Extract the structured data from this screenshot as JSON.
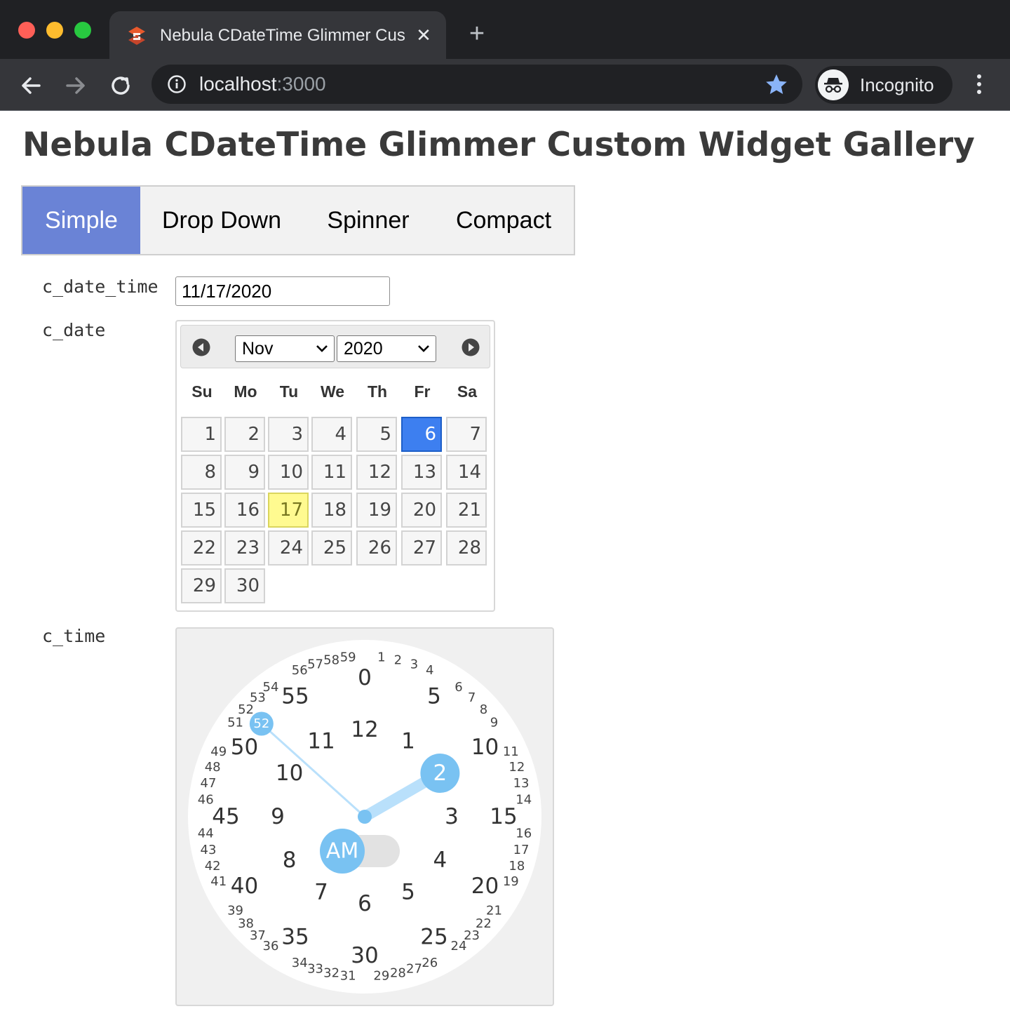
{
  "browser": {
    "tab_title": "Nebula CDateTime Glimmer Custom Widget Gallery",
    "tab_close": "✕",
    "new_tab": "+",
    "url_host": "localhost",
    "url_port": ":3000",
    "profile_label": "Incognito"
  },
  "page": {
    "title": "Nebula CDateTime Glimmer Custom Widget Gallery"
  },
  "tabs": [
    {
      "label": "Simple",
      "active": true
    },
    {
      "label": "Drop Down",
      "active": false
    },
    {
      "label": "Spinner",
      "active": false
    },
    {
      "label": "Compact",
      "active": false
    }
  ],
  "fields": {
    "c_date_time": {
      "label": "c_date_time",
      "value": "11/17/2020"
    },
    "c_date": {
      "label": "c_date"
    },
    "c_time": {
      "label": "c_time"
    }
  },
  "calendar": {
    "month": "Nov",
    "year": "2020",
    "weekdays": [
      "Su",
      "Mo",
      "Tu",
      "We",
      "Th",
      "Fr",
      "Sa"
    ],
    "first_weekday_index": 0,
    "days_in_month": 30,
    "today": 17,
    "selected": 6
  },
  "clock": {
    "hour": 2,
    "minute": 52,
    "period": "AM",
    "accent_color": "#79c2f2",
    "hand_color": "#b9e0fb"
  }
}
